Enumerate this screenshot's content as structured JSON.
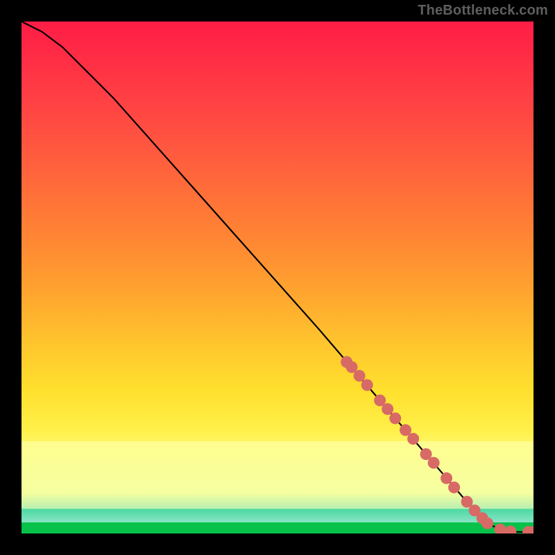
{
  "watermark": "TheBottleneck.com",
  "chart_data": {
    "type": "line",
    "title": "",
    "xlabel": "",
    "ylabel": "",
    "xlim": [
      0,
      100
    ],
    "ylim": [
      0,
      100
    ],
    "grid": false,
    "legend": false,
    "series": [
      {
        "name": "curve",
        "stroke": "#000000",
        "x": [
          0,
          4,
          8,
          12,
          18,
          26,
          34,
          42,
          50,
          58,
          64,
          70,
          76,
          82,
          88,
          91,
          93,
          95,
          97,
          100
        ],
        "y": [
          100,
          98,
          95,
          91,
          85,
          76,
          67,
          58,
          49,
          40,
          33,
          26,
          19,
          12,
          5,
          2,
          1,
          0.5,
          0.3,
          0.3
        ]
      }
    ],
    "markers": [
      {
        "name": "segment-markers",
        "color": "#d86a66",
        "points": [
          {
            "x": 63.5,
            "y": 33.5
          },
          {
            "x": 64.5,
            "y": 32.5
          },
          {
            "x": 66.0,
            "y": 30.8
          },
          {
            "x": 67.5,
            "y": 29.0
          },
          {
            "x": 70.0,
            "y": 26.0
          },
          {
            "x": 71.5,
            "y": 24.3
          },
          {
            "x": 73.0,
            "y": 22.5
          },
          {
            "x": 75.0,
            "y": 20.2
          },
          {
            "x": 76.5,
            "y": 18.5
          },
          {
            "x": 79.0,
            "y": 15.5
          },
          {
            "x": 80.5,
            "y": 13.8
          },
          {
            "x": 83.0,
            "y": 10.8
          },
          {
            "x": 84.5,
            "y": 9.0
          },
          {
            "x": 87.0,
            "y": 6.2
          },
          {
            "x": 88.5,
            "y": 4.5
          },
          {
            "x": 90.0,
            "y": 3.0
          },
          {
            "x": 91.0,
            "y": 2.0
          },
          {
            "x": 93.5,
            "y": 0.8
          },
          {
            "x": 95.5,
            "y": 0.4
          },
          {
            "x": 99.0,
            "y": 0.3
          },
          {
            "x": 100.0,
            "y": 0.3
          }
        ]
      }
    ],
    "background_gradient": {
      "direction": "vertical",
      "stops": [
        {
          "pos": 0.0,
          "color": "#ff1d46"
        },
        {
          "pos": 0.45,
          "color": "#ff8a33"
        },
        {
          "pos": 0.72,
          "color": "#ffe02e"
        },
        {
          "pos": 0.86,
          "color": "#fffd8f"
        },
        {
          "pos": 0.96,
          "color": "#4ad9a0"
        },
        {
          "pos": 1.0,
          "color": "#06c24a"
        }
      ]
    }
  }
}
